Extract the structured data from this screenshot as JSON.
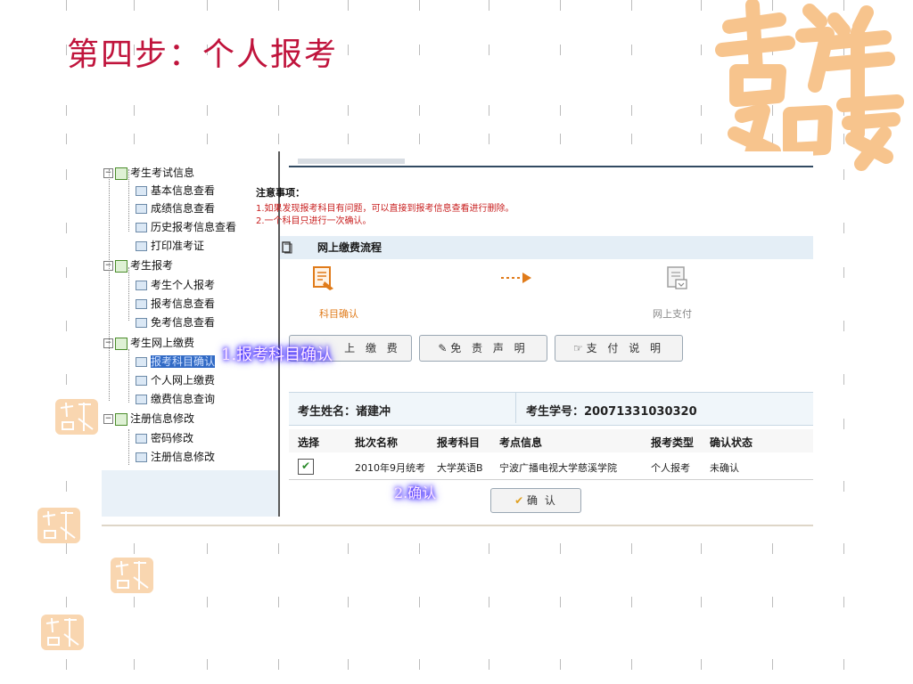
{
  "slide": {
    "title": "第四步：个人报考"
  },
  "sidebar": {
    "groups": [
      {
        "label": "考生考试信息",
        "items": [
          "基本信息查看",
          "成绩信息查看",
          "历史报考信息查看",
          "打印准考证"
        ]
      },
      {
        "label": "考生报考",
        "items": [
          "考生个人报考",
          "报考信息查看",
          "免考信息查看"
        ]
      },
      {
        "label": "考生网上缴费",
        "items": [
          "报考科目确认",
          "个人网上缴费",
          "缴费信息查询"
        ]
      },
      {
        "label": "注册信息修改",
        "items": [
          "密码修改",
          "注册信息修改"
        ]
      }
    ],
    "selected_item": "报考科目确认"
  },
  "notice": {
    "title": "注意事项：",
    "lines": [
      "1.如果发现报考科目有问题，可以直接到报考信息查看进行删除。",
      "2.一个科目只进行一次确认。"
    ]
  },
  "flow": {
    "title": "网上缴费流程",
    "step1_label": "科目确认",
    "step2_label": "网上支付"
  },
  "buttons": {
    "pay": "上 缴 费",
    "disclaimer": "免 责 声 明",
    "payment_info": "支 付 说 明",
    "confirm": "确  认"
  },
  "student": {
    "name_label": "考生姓名：",
    "name": "诸建冲",
    "id_label": "考生学号：",
    "id": "20071331030320"
  },
  "table": {
    "headers": [
      "选择",
      "批次名称",
      "报考科目",
      "考点信息",
      "报考类型",
      "确认状态"
    ],
    "row": {
      "checked": true,
      "batch": "2010年9月统考",
      "subject": "大学英语B",
      "venue": "宁波广播电视大学慈溪学院",
      "type": "个人报考",
      "status": "未确认"
    }
  },
  "annotations": {
    "step1": "1.报考科目确认",
    "step2": "2.确认"
  },
  "colors": {
    "title": "#c0143c",
    "notice": "#c81e1e",
    "annotation_glow": "#2b1bff",
    "logo": "#f7c48d"
  }
}
